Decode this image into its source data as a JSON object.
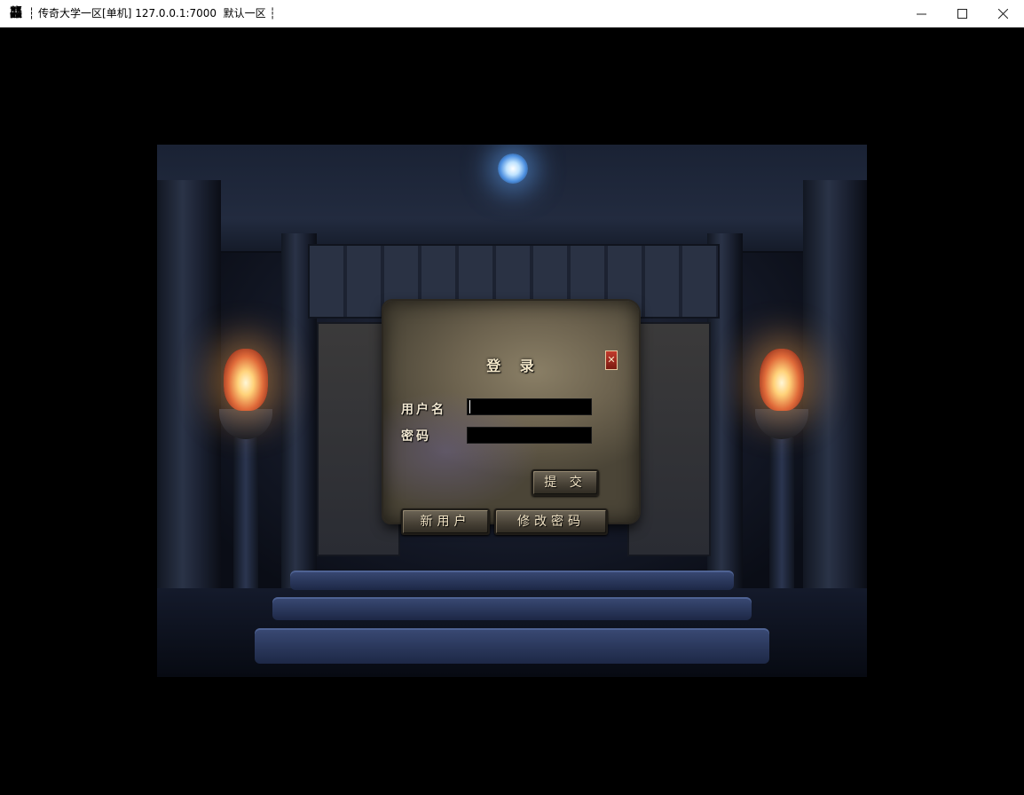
{
  "window": {
    "icon_glyph": "龘",
    "title": "┆ 传奇大学一区[单机] 127.0.0.1:7000  默认一区 ┆",
    "controls": {
      "minimize": "minimize-icon",
      "maximize": "maximize-icon",
      "close": "close-icon"
    }
  },
  "login_dialog": {
    "title": "登 录",
    "close_icon": "close-icon",
    "username_label": "用户名",
    "username_value": "",
    "password_label": "密码",
    "password_value": "",
    "submit_label": "提 交",
    "new_user_label": "新用户",
    "change_password_label": "修改密码"
  },
  "colors": {
    "title_bar": "#ffffff",
    "background": "#000000",
    "dialog_stone": "#6d634f",
    "label_text": "#f0e6d0",
    "torch_glow": "#ffb060",
    "orb_glow": "#64aaff"
  }
}
